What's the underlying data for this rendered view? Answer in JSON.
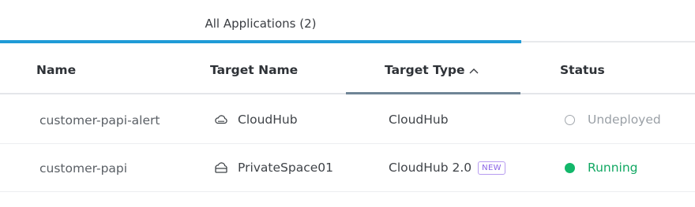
{
  "tabs": [
    {
      "label": "All Applications (2)",
      "active": true
    }
  ],
  "table": {
    "columns": {
      "name": "Name",
      "target_name": "Target Name",
      "target_type": "Target Type",
      "status": "Status"
    },
    "sort": {
      "column": "Target Type",
      "direction": "ascending",
      "indicator": "^"
    },
    "rows": [
      {
        "name": "customer-papi-alert",
        "target_icon": "cloud-icon",
        "target_name": "CloudHub",
        "target_type": "CloudHub",
        "badge": "",
        "status": "Undeployed",
        "status_color": "#9aa0a6"
      },
      {
        "name": "customer-papi",
        "target_icon": "private-space-icon",
        "target_name": "PrivateSpace01",
        "target_type": "CloudHub 2.0",
        "badge": "NEW",
        "status": "Running",
        "status_color": "#12b76a"
      }
    ]
  },
  "colors": {
    "tab_underline": "#1f9bd7",
    "sort_underline": "#6f8596",
    "badge": "#8a63e6"
  }
}
